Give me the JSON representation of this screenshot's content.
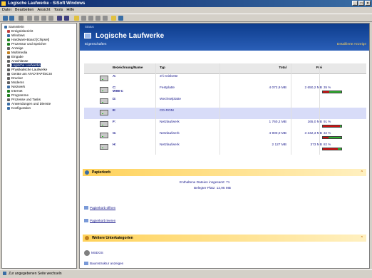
{
  "window": {
    "title": "Logische Laufwerke - SiSoft Windows"
  },
  "menu": [
    "Datei",
    "Bearbeiten",
    "Ansicht",
    "Tools",
    "Hilfe"
  ],
  "tree": [
    "Sammlerin",
    "Ereignisbericht",
    "Windows",
    "Hardware-Board [Chipset]",
    "Prozessor und Speicher",
    "Anzeige",
    "Multimedia",
    "Eingabe",
    "Anschlüsse",
    "Logische Laufwerke",
    "Physikalische Laufwerke",
    "Geräte am ATA/ATAPI/SCSI",
    "Drucker",
    "Modems",
    "Netzwerk",
    "Internet",
    "Programme",
    "Prozesse und Tasks",
    "Anwendungen und Dienste",
    "Konfiguration"
  ],
  "banner": {
    "crumb": "Status",
    "title": "Logische Laufwerke",
    "left_link": "Eigenschaften",
    "right_link": "Detaillierte Anzeige"
  },
  "columns": {
    "name": "Bezeichnung/Name",
    "type": "Typ",
    "total": "Total",
    "free": "Frei"
  },
  "drives": [
    {
      "letter": "A:",
      "type": "3½-Diskette",
      "total": "",
      "free": "",
      "pct": "",
      "used": 0
    },
    {
      "letter": "C:\nW98-C",
      "type": "Festplatte",
      "total": "4 072,9 MB",
      "free": "2 650,2 MB",
      "pct": "35 %",
      "used": 0.35
    },
    {
      "letter": "D:",
      "type": "Wechselplatte",
      "total": "",
      "free": "",
      "pct": "",
      "used": 0
    },
    {
      "letter": "E:",
      "type": "CD-ROM",
      "total": "",
      "free": "",
      "pct": "",
      "used": 0
    },
    {
      "letter": "F:",
      "type": "Netzlaufwerk",
      "total": "1 760,2 MB",
      "free": "165,0 MB",
      "pct": "91 %",
      "used": 0.91
    },
    {
      "letter": "G:",
      "type": "Netzlaufwerk",
      "total": "4 900,0 MB",
      "free": "3 342,3 MB",
      "pct": "32 %",
      "used": 0.32
    },
    {
      "letter": "H:",
      "type": "Netzlaufwerk",
      "total": "2 127 MB",
      "free": "373 MB",
      "pct": "82 %",
      "used": 0.82
    }
  ],
  "recycle": {
    "title": "Papierkorb",
    "line1": "Enthaltene Dateien insgesamt: 71",
    "line2": "Belegter Platz: 12,95 MB",
    "action1": "Papierkorb öffnen",
    "action2": "Papierkorb leeren"
  },
  "further": {
    "title": "Weitere Unterkategorien",
    "item1": "MSDOS",
    "item2": "Baumstruktur anzeigen"
  },
  "status": "Zur angegebenen Seite wechseln"
}
